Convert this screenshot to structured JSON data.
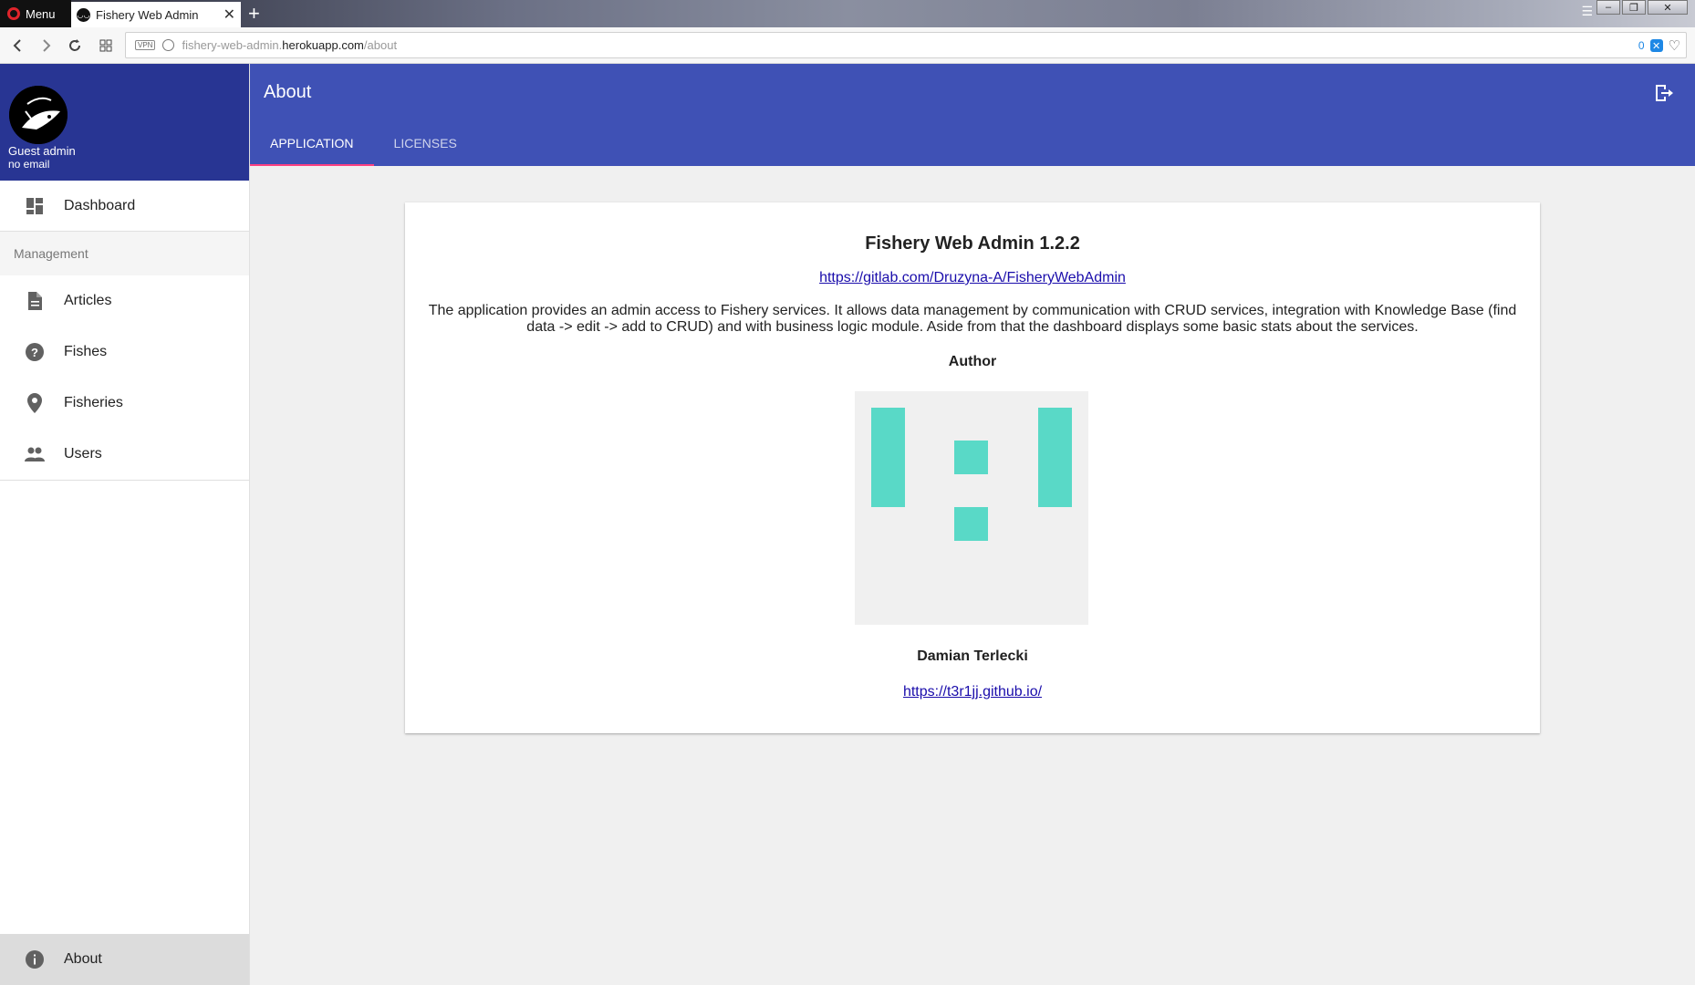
{
  "browser": {
    "menu_label": "Menu",
    "tab_title": "Fishery Web Admin",
    "new_tab_label": "+",
    "url_prefix": "fishery-web-admin.",
    "url_domain": "herokuapp.com",
    "url_path": "/about",
    "vpn_label": "VPN",
    "adblock_count": "0"
  },
  "sidebar": {
    "user_name": "Guest admin",
    "user_email": "no email",
    "dashboard_label": "Dashboard",
    "section_label": "Management",
    "items": [
      {
        "label": "Articles",
        "icon": "article-icon"
      },
      {
        "label": "Fishes",
        "icon": "help-circle-icon"
      },
      {
        "label": "Fisheries",
        "icon": "map-pin-icon"
      },
      {
        "label": "Users",
        "icon": "people-icon"
      }
    ],
    "about_label": "About"
  },
  "header": {
    "title": "About",
    "tabs": [
      {
        "label": "APPLICATION",
        "active": true
      },
      {
        "label": "LICENSES",
        "active": false
      }
    ]
  },
  "about": {
    "app_title": "Fishery Web Admin 1.2.2",
    "repo_url": "https://gitlab.com/Druzyna-A/FisheryWebAdmin",
    "description": "The application provides an admin access to Fishery services. It allows data management by communication with CRUD services, integration with Knowledge Base (find data -> edit -> add to CRUD) and with business logic module. Aside from that the dashboard displays some basic stats about the services.",
    "author_heading": "Author",
    "author_name": "Damian Terlecki",
    "author_url": "https://t3r1jj.github.io/"
  },
  "colors": {
    "primary": "#3f51b5",
    "primary_dark": "#283593",
    "accent": "#ff4081",
    "identicon": "#59d9c7"
  }
}
